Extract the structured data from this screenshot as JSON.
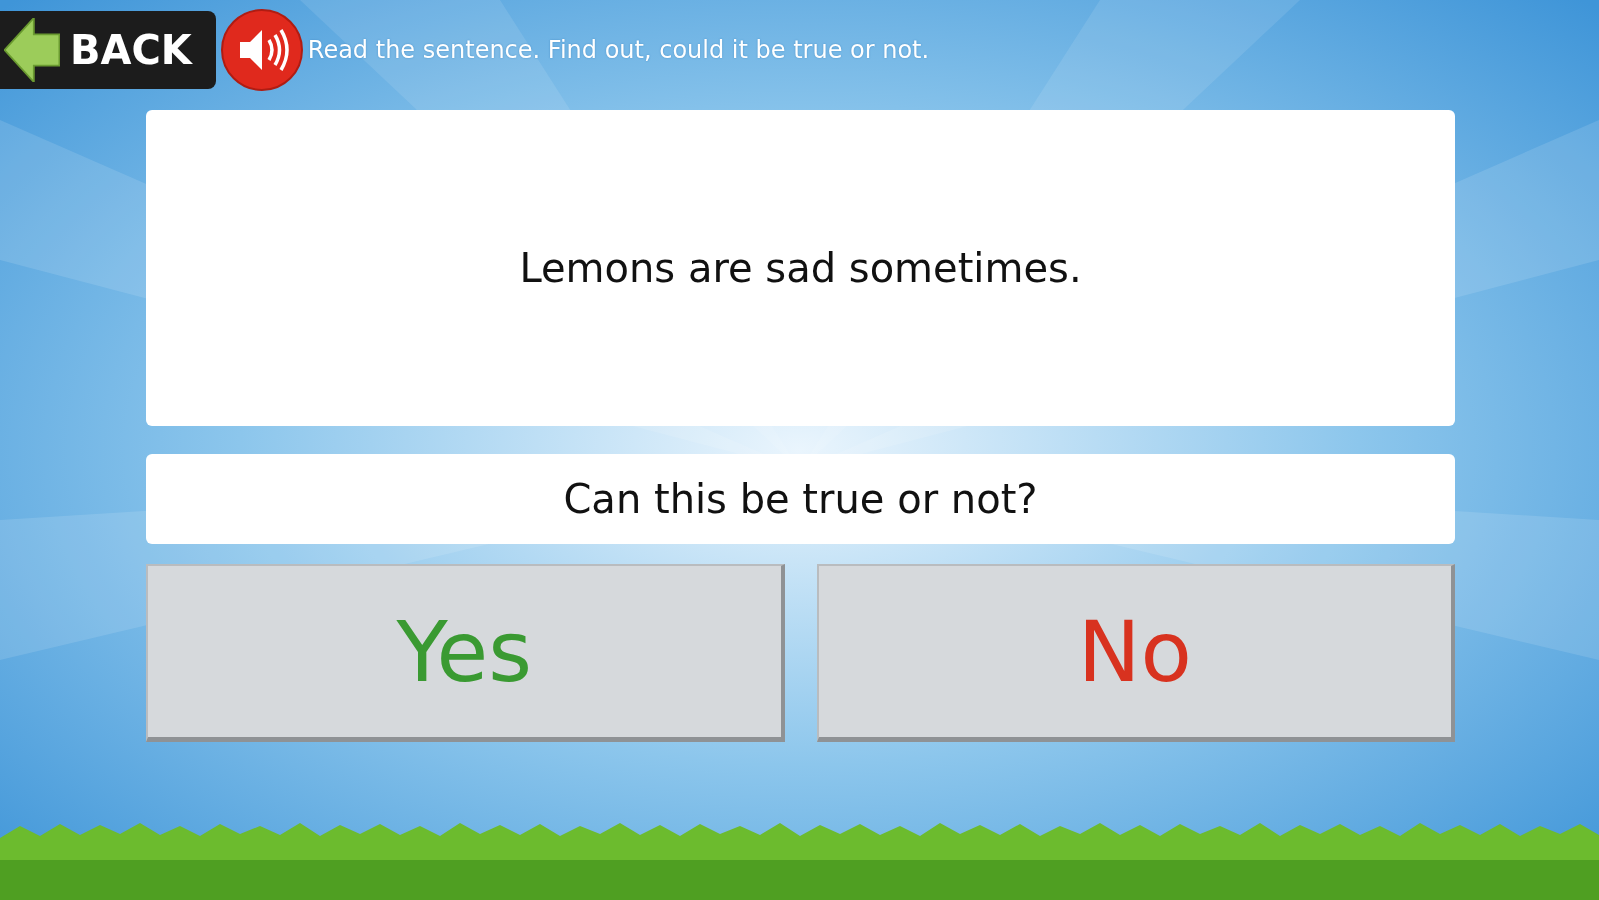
{
  "back_button": {
    "label": "BACK"
  },
  "instruction": "Read the sentence. Find out, could it be true or not.",
  "sentence": "Lemons are sad sometimes.",
  "question": "Can this be true or not?",
  "answers": [
    {
      "label": "Yes",
      "kind": "yes"
    },
    {
      "label": "No",
      "kind": "no"
    }
  ]
}
